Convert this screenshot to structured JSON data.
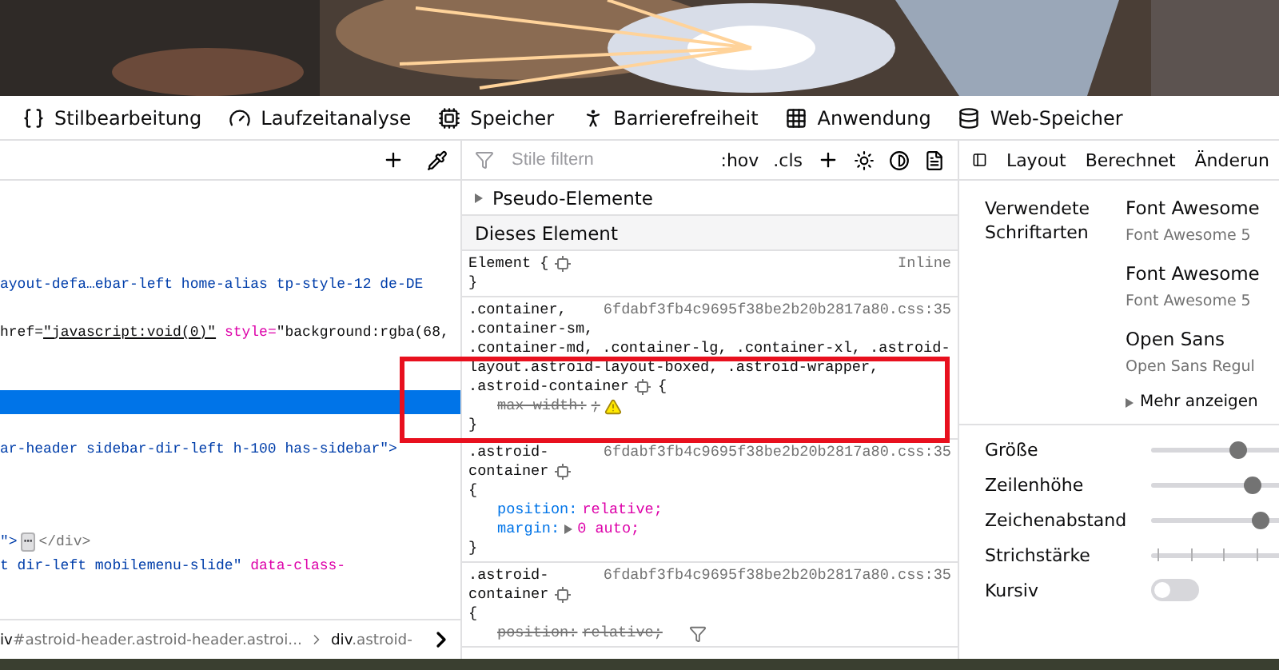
{
  "toolbar": {
    "tabs": [
      "Stilbearbeitung",
      "Laufzeitanalyse",
      "Speicher",
      "Barrierefreiheit",
      "Anwendung",
      "Web-Speicher"
    ]
  },
  "markup": {
    "lines": [
      {
        "selected": false
      },
      {
        "selected": false
      },
      {
        "selected": false
      },
      {
        "selected": false
      },
      {
        "selected": false,
        "segments": [
          {
            "kind": "value",
            "text": "ayout-defa…ebar-left home-alias tp-style-12 de-DE"
          }
        ]
      },
      {
        "selected": false
      },
      {
        "selected": false,
        "segments": [
          {
            "kind": "plain",
            "text": "href="
          },
          {
            "kind": "link",
            "text": "\"javascript:void(0)\""
          },
          {
            "kind": "attr",
            "text": " style="
          },
          {
            "kind": "plain",
            "text": "\"background:rgba(68,"
          }
        ]
      },
      {
        "selected": false
      },
      {
        "selected": false
      },
      {
        "selected": true
      },
      {
        "selected": false
      },
      {
        "selected": false,
        "segments": [
          {
            "kind": "value",
            "text": "ar-header sidebar-dir-left h-100 has-sidebar\">"
          }
        ]
      },
      {
        "selected": false
      },
      {
        "selected": false
      },
      {
        "selected": false
      },
      {
        "selected": false,
        "segments": [
          {
            "kind": "value",
            "text": "\">"
          },
          {
            "kind": "ellipsis",
            "text": "⋯"
          },
          {
            "kind": "tag",
            "text": "</div>"
          }
        ]
      },
      {
        "selected": false,
        "segments": [
          {
            "kind": "value",
            "text": "t dir-left mobilemenu-slide\""
          },
          {
            "kind": "attr",
            "text": " data-class-"
          }
        ]
      }
    ],
    "breadcrumbs": [
      {
        "tag": "iv",
        "rest": "#astroid-header.astroid-header.astroi..."
      },
      {
        "tag": "div",
        "rest": ".astroid-"
      }
    ]
  },
  "rules": {
    "filter_placeholder": "Stile filtern",
    "toggles": [
      ":hov",
      ".cls"
    ],
    "pseudo": "Pseudo-Elemente",
    "section": "Dieses Element",
    "blocks": [
      {
        "source": "Inline",
        "head": [
          [
            {
              "kind": "text",
              "text": "Element {"
            },
            {
              "kind": "gear"
            }
          ]
        ],
        "close": "}"
      },
      {
        "source": "6fdabf3fb4c9695f38be2b20b2817a80.css:35",
        "head": [
          [
            {
              "kind": "text",
              "text": ".container,"
            }
          ],
          [
            {
              "kind": "text",
              "text": ".container-sm,"
            }
          ],
          [
            {
              "kind": "text",
              "text": ".container-md, .container-lg, .container-xl, .astroid-"
            }
          ],
          [
            {
              "kind": "text",
              "text": "layout.astroid-layout-boxed, .astroid-wrapper,"
            }
          ],
          [
            {
              "kind": "text",
              "text": ".astroid-container"
            },
            {
              "kind": "gear"
            },
            {
              "kind": "text",
              "text": "{"
            }
          ]
        ],
        "declarations": [
          {
            "kind": "warning",
            "name": "max-width:",
            "value": ";",
            "overridden": true
          }
        ],
        "close": "}"
      },
      {
        "source": "6fdabf3fb4c9695f38be2b20b2817a80.css:35",
        "head": [
          [
            {
              "kind": "text",
              "text": ".astroid-"
            }
          ],
          [
            {
              "kind": "text",
              "text": "container"
            },
            {
              "kind": "gear"
            }
          ],
          [
            {
              "kind": "text",
              "text": "{"
            }
          ]
        ],
        "declarations": [
          {
            "kind": "plain",
            "name": "position:",
            "value": "relative;",
            "overridden": false
          },
          {
            "kind": "expandable",
            "name": "margin:",
            "value": "0 auto;",
            "overridden": false
          }
        ],
        "close": "}"
      },
      {
        "source": "6fdabf3fb4c9695f38be2b20b2817a80.css:35",
        "head": [
          [
            {
              "kind": "text",
              "text": ".astroid-"
            }
          ],
          [
            {
              "kind": "text",
              "text": "container"
            },
            {
              "kind": "gear"
            }
          ],
          [
            {
              "kind": "text",
              "text": "{"
            }
          ]
        ],
        "declarations": [
          {
            "kind": "filtered",
            "name": "position:",
            "value": "relative;",
            "overridden": true
          }
        ]
      }
    ]
  },
  "fonts": {
    "tabs": [
      "Layout",
      "Berechnet",
      "Änderun"
    ],
    "label": "Verwendete Schriftarten",
    "used": [
      {
        "name": "Font Awesome",
        "detail": "Font Awesome 5"
      },
      {
        "name": "Font Awesome",
        "detail": "Font Awesome 5"
      },
      {
        "name": "Open Sans",
        "detail": "Open Sans Regul"
      }
    ],
    "more": "Mehr anzeigen",
    "controls": [
      {
        "kind": "slider",
        "label": "Größe",
        "level": 0.66
      },
      {
        "kind": "slider",
        "label": "Zeilenhöhe",
        "level": 0.77
      },
      {
        "kind": "slider",
        "label": "Zeichenabstand",
        "level": 0.83
      },
      {
        "kind": "ticks",
        "label": "Strichstärke"
      },
      {
        "kind": "toggle",
        "label": "Kursiv",
        "on": false
      }
    ]
  }
}
